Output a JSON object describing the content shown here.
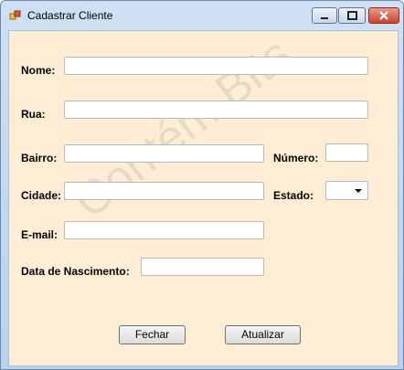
{
  "window": {
    "title": "Cadastrar Cliente"
  },
  "watermark": "Contém Bits",
  "form": {
    "nome": {
      "label": "Nome:",
      "value": ""
    },
    "rua": {
      "label": "Rua:",
      "value": ""
    },
    "bairro": {
      "label": "Bairro:",
      "value": ""
    },
    "numero": {
      "label": "Número:",
      "value": ""
    },
    "cidade": {
      "label": "Cidade:",
      "value": ""
    },
    "estado": {
      "label": "Estado:",
      "value": ""
    },
    "email": {
      "label": "E-mail:",
      "value": ""
    },
    "nascimento": {
      "label": "Data de Nascimento:",
      "value": ""
    }
  },
  "buttons": {
    "fechar": "Fechar",
    "atualizar": "Atualizar"
  },
  "colors": {
    "client_bg": "#ffeed5",
    "close_button": "#c9452f"
  }
}
